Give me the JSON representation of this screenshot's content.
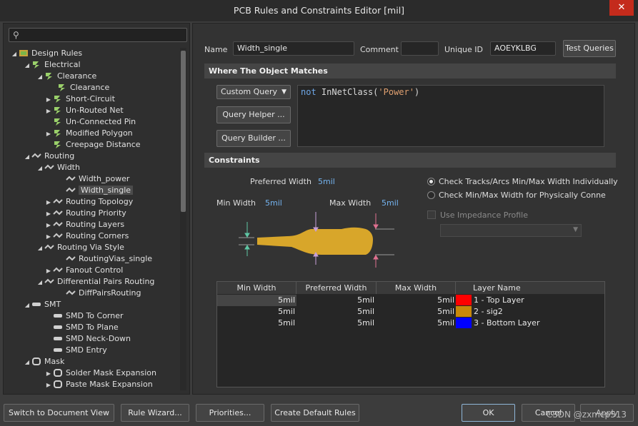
{
  "window": {
    "title": "PCB Rules and Constraints Editor [mil]",
    "close_glyph": "✕"
  },
  "search": {
    "placeholder": ""
  },
  "tree": [
    {
      "label": "Design Rules"
    },
    {
      "label": "Electrical"
    },
    {
      "label": "Clearance"
    },
    {
      "label": "Clearance"
    },
    {
      "label": "Short-Circuit"
    },
    {
      "label": "Un-Routed Net"
    },
    {
      "label": "Un-Connected Pin"
    },
    {
      "label": "Modified Polygon"
    },
    {
      "label": "Creepage Distance"
    },
    {
      "label": "Routing"
    },
    {
      "label": "Width"
    },
    {
      "label": "Width_power"
    },
    {
      "label": "Width_single"
    },
    {
      "label": "Routing Topology"
    },
    {
      "label": "Routing Priority"
    },
    {
      "label": "Routing Layers"
    },
    {
      "label": "Routing Corners"
    },
    {
      "label": "Routing Via Style"
    },
    {
      "label": "RoutingVias_single"
    },
    {
      "label": "Fanout Control"
    },
    {
      "label": "Differential Pairs Routing"
    },
    {
      "label": "DiffPairsRouting"
    },
    {
      "label": "SMT"
    },
    {
      "label": "SMD To Corner"
    },
    {
      "label": "SMD To Plane"
    },
    {
      "label": "SMD Neck-Down"
    },
    {
      "label": "SMD Entry"
    },
    {
      "label": "Mask"
    },
    {
      "label": "Solder Mask Expansion"
    },
    {
      "label": "Paste Mask Expansion"
    }
  ],
  "rule": {
    "name_label": "Name",
    "name_value": "Width_single",
    "comment_label": "Comment",
    "comment_value": "",
    "uid_label": "Unique ID",
    "uid_value": "AOEYKLBG",
    "test_queries": "Test Queries"
  },
  "where": {
    "header": "Where The Object Matches",
    "query_type": "Custom Query",
    "query_helper": "Query Helper ...",
    "query_builder": "Query Builder ...",
    "query_kw": "not",
    "query_fn": "InNetClass(",
    "query_str": "'Power'",
    "query_close": ")"
  },
  "constraints": {
    "header": "Constraints",
    "preferred_label": "Preferred Width",
    "preferred_value": "5mil",
    "min_label": "Min Width",
    "min_value": "5mil",
    "max_label": "Max Width",
    "max_value": "5mil",
    "radio1": "Check Tracks/Arcs Min/Max Width Individually",
    "radio2": "Check Min/Max Width for Physically Connected",
    "impedance": "Use Impedance Profile"
  },
  "table": {
    "headers": [
      "Min Width",
      "Preferred Width",
      "Max Width",
      "Layer Name"
    ],
    "rows": [
      {
        "min": "5mil",
        "pref": "5mil",
        "max": "5mil",
        "layer": "1 - Top Layer",
        "color": "#ff0000"
      },
      {
        "min": "5mil",
        "pref": "5mil",
        "max": "5mil",
        "layer": "2 - sig2",
        "color": "#c8880a"
      },
      {
        "min": "5mil",
        "pref": "5mil",
        "max": "5mil",
        "layer": "3 - Bottom Layer",
        "color": "#0000ff"
      }
    ]
  },
  "buttons": {
    "switch_view": "Switch to Document View",
    "rule_wizard": "Rule Wizard...",
    "priorities": "Priorities...",
    "create_default": "Create Default Rules",
    "ok": "OK",
    "cancel": "Cancel",
    "apply": "Apply"
  },
  "watermark": "CSDN @zxmcp513"
}
